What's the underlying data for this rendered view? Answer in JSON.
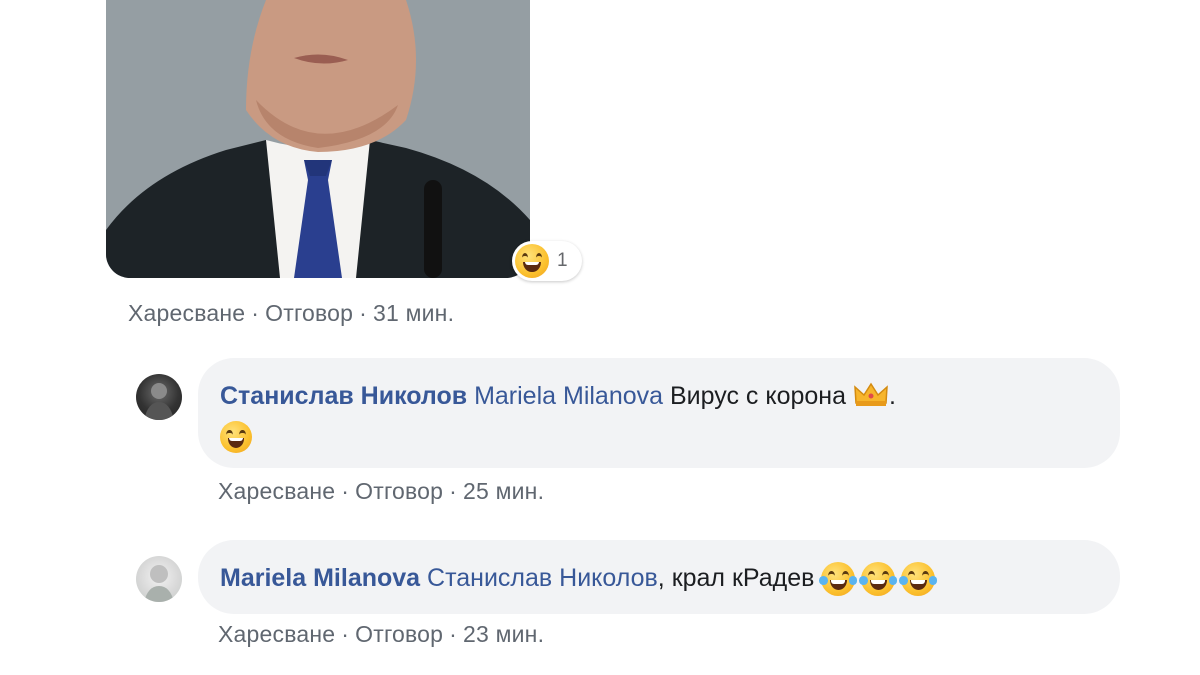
{
  "top_comment": {
    "reaction": {
      "icon": "haha-emoji-icon",
      "count": "1"
    },
    "meta": {
      "like": "Харесване",
      "reply": "Отговор",
      "time": "31 мин."
    }
  },
  "replies": [
    {
      "author": "Станислав Николов",
      "mention": "Mariela Milanova",
      "text": "Вирус с корона",
      "emoji_after_text": "crown-emoji-icon",
      "trailing_punct": ".",
      "line2_emoji": "grin-emoji-icon",
      "meta": {
        "like": "Харесване",
        "reply": "Отговор",
        "time": "25 мин."
      }
    },
    {
      "author": "Mariela Milanova",
      "mention": "Станислав Николов",
      "text": ", крал кРадев",
      "emojis": [
        "laughing-tears-emoji-icon",
        "laughing-tears-emoji-icon",
        "laughing-tears-emoji-icon"
      ],
      "meta": {
        "like": "Харесване",
        "reply": "Отговор",
        "time": "23 мин."
      }
    }
  ],
  "meta_separator": "·",
  "colors": {
    "author": "#385898",
    "meta": "#606770",
    "bubble": "#f2f3f5"
  }
}
